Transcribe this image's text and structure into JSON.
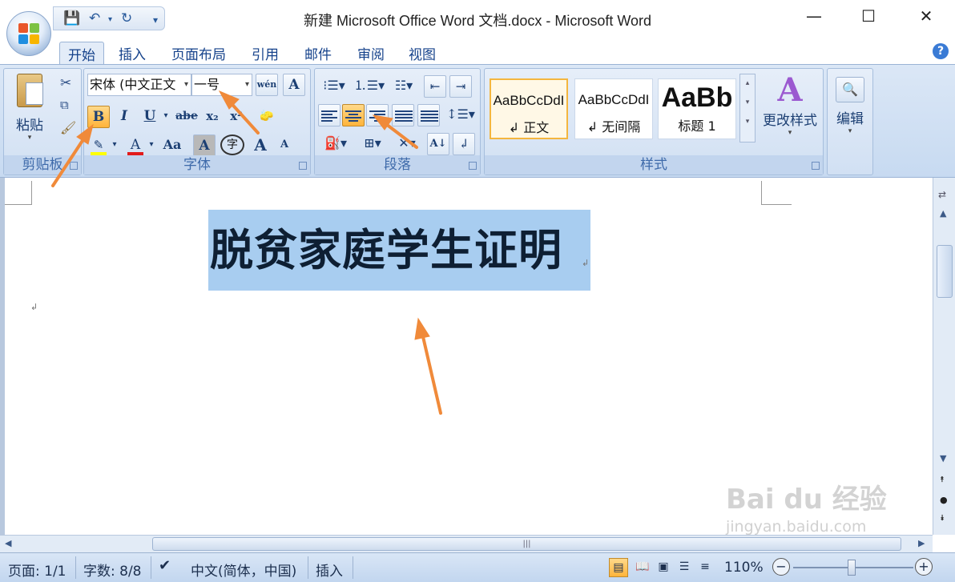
{
  "window": {
    "title": "新建 Microsoft Office Word 文档.docx - Microsoft Word",
    "minimize": "—",
    "maximize": "☐",
    "close": "✕"
  },
  "tabs": [
    {
      "label": "开始",
      "active": true
    },
    {
      "label": "插入"
    },
    {
      "label": "页面布局"
    },
    {
      "label": "引用"
    },
    {
      "label": "邮件"
    },
    {
      "label": "审阅"
    },
    {
      "label": "视图"
    }
  ],
  "ribbon": {
    "clipboard": {
      "paste_label": "粘贴",
      "group_label": "剪贴板"
    },
    "font": {
      "font_name": "宋体 (中文正文",
      "font_size": "一号",
      "bold": "B",
      "italic": "I",
      "underline": "U",
      "strike": "abe",
      "subscript": "x₂",
      "superscript": "x²",
      "change_case": "Aa",
      "char_border": "A",
      "enclose": "字",
      "grow": "A",
      "shrink": "A",
      "phonetic": "wén",
      "group_label": "字体"
    },
    "paragraph": {
      "group_label": "段落"
    },
    "styles": {
      "cards": [
        {
          "sample": "AaBbCcDdI",
          "name": "↲ 正文",
          "selected": true
        },
        {
          "sample": "AaBbCcDdI",
          "name": "↲ 无间隔"
        },
        {
          "sample": "AaBb",
          "name": "标题 1"
        }
      ],
      "change_styles": "更改样式",
      "group_label": "样式"
    },
    "editing": {
      "label": "编辑"
    }
  },
  "document": {
    "title_text": "脱贫家庭学生证明",
    "para_mark": "↲"
  },
  "statusbar": {
    "page": "页面: 1/1",
    "words": "字数: 8/8",
    "language": "中文(简体，中国)",
    "mode": "插入",
    "zoom": "110%"
  },
  "watermark": {
    "brand": "Bai du 经验",
    "url": "jingyan.baidu.com"
  },
  "colors": {
    "highlight_selected": "#a8cdf0",
    "button_highlight": "#ffb43b",
    "annotation_arrow": "#f08a3a"
  }
}
